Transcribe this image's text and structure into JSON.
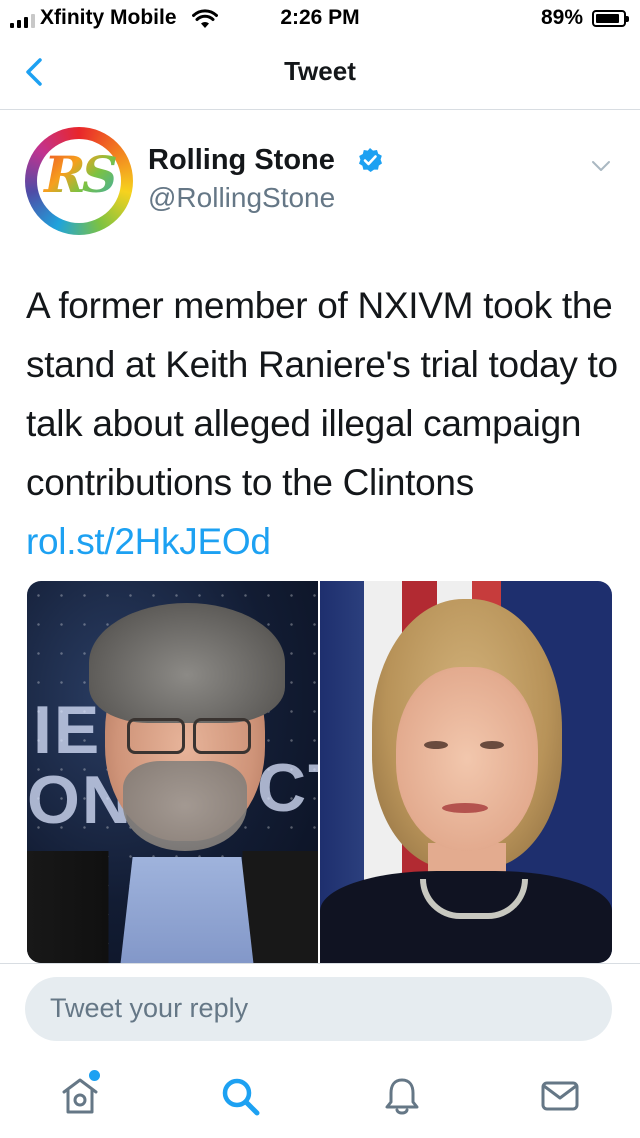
{
  "status_bar": {
    "carrier": "Xfinity Mobile",
    "time": "2:26 PM",
    "battery_percent": "89%",
    "battery_level": 0.89,
    "signal_bars": 3
  },
  "nav": {
    "title": "Tweet",
    "back_icon": "chevron-left-icon"
  },
  "tweet": {
    "display_name": "Rolling Stone",
    "verified": true,
    "handle": "@RollingStone",
    "avatar_letters": "RS",
    "text": "A former member of NXIVM took the stand at Keith Raniere's trial today to talk about alleged illegal campaign contributions to the Clintons ",
    "link": "rol.st/2HkJEOd",
    "media": {
      "left_bg_text_1": "IE",
      "left_bg_text_2": "ON",
      "left_bg_text_3": "CT"
    }
  },
  "reply": {
    "placeholder": "Tweet your reply"
  },
  "tab_bar": {
    "items": [
      "home-icon",
      "search-icon",
      "notifications-icon",
      "messages-icon"
    ]
  },
  "colors": {
    "accent": "#1da1f2",
    "text": "#14171a",
    "secondary": "#657786",
    "reply_bg": "#e6ecf0"
  }
}
